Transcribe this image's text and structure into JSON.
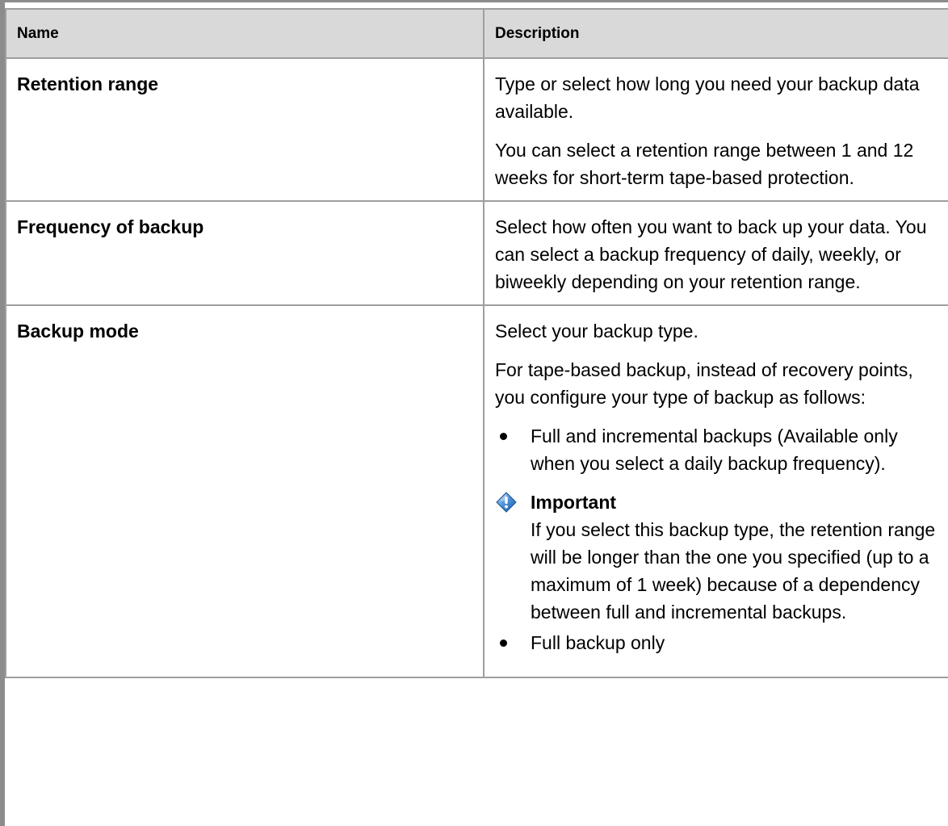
{
  "table": {
    "headers": {
      "name": "Name",
      "description": "Description"
    },
    "rows": [
      {
        "name": "Retention range",
        "paragraphs": [
          "Type or select how long you need your backup data available.",
          "You can select a retention range between 1 and 12 weeks for short-term tape-based protection."
        ]
      },
      {
        "name": "Frequency of backup",
        "paragraphs": [
          "Select how often you want to back up your data. You can select a backup frequency of daily, weekly, or biweekly depending on your retention range."
        ]
      },
      {
        "name": "Backup mode",
        "paragraphs": [
          "Select your backup type.",
          "For tape-based backup, instead of recovery points, you configure your type of backup as follows:"
        ],
        "bullets": [
          "Full and incremental backups (Available only when you select a daily backup frequency).",
          "Full backup only"
        ],
        "alert": {
          "icon": "important-icon",
          "title": "Important",
          "text": "If you select this backup type, the retention range will be longer than the one you specified (up to a maximum of 1 week) because of a dependency between full and incremental backups."
        }
      }
    ]
  },
  "colors": {
    "header_bg": "#d9d9d9",
    "border": "#9e9e9e",
    "frame": "#8c8c8c"
  }
}
